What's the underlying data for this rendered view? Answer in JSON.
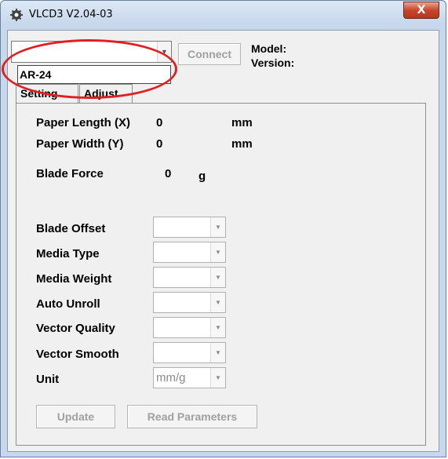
{
  "window": {
    "title": "VLCD3 V2.04-03",
    "close_glyph": "X",
    "icon": "gear-icon"
  },
  "connection": {
    "port_value": "",
    "dropdown_option": "AR-24",
    "connect_label": "Connect",
    "model_label": "Model:",
    "version_label": "Version:"
  },
  "tabs": [
    {
      "label": "Setting",
      "active": true
    },
    {
      "label": "Adjust",
      "active": false
    }
  ],
  "setting": {
    "paper_length_label": "Paper Length (X)",
    "paper_length_value": "0",
    "paper_length_unit": "mm",
    "paper_width_label": "Paper Width (Y)",
    "paper_width_value": "0",
    "paper_width_unit": "mm",
    "blade_force_label": "Blade Force",
    "blade_force_value": "0",
    "blade_force_unit": "g",
    "params": [
      {
        "label": "Blade Offset",
        "value": ""
      },
      {
        "label": "Media Type",
        "value": ""
      },
      {
        "label": "Media Weight",
        "value": ""
      },
      {
        "label": "Auto Unroll",
        "value": ""
      },
      {
        "label": "Vector Quality",
        "value": ""
      },
      {
        "label": "Vector Smooth",
        "value": ""
      },
      {
        "label": "Unit",
        "value": "mm/g"
      }
    ],
    "update_label": "Update",
    "read_params_label": "Read Parameters"
  },
  "colors": {
    "highlight": "#e02020",
    "disabled_text": "#a0a0a0",
    "close_button": "#c9462c"
  }
}
